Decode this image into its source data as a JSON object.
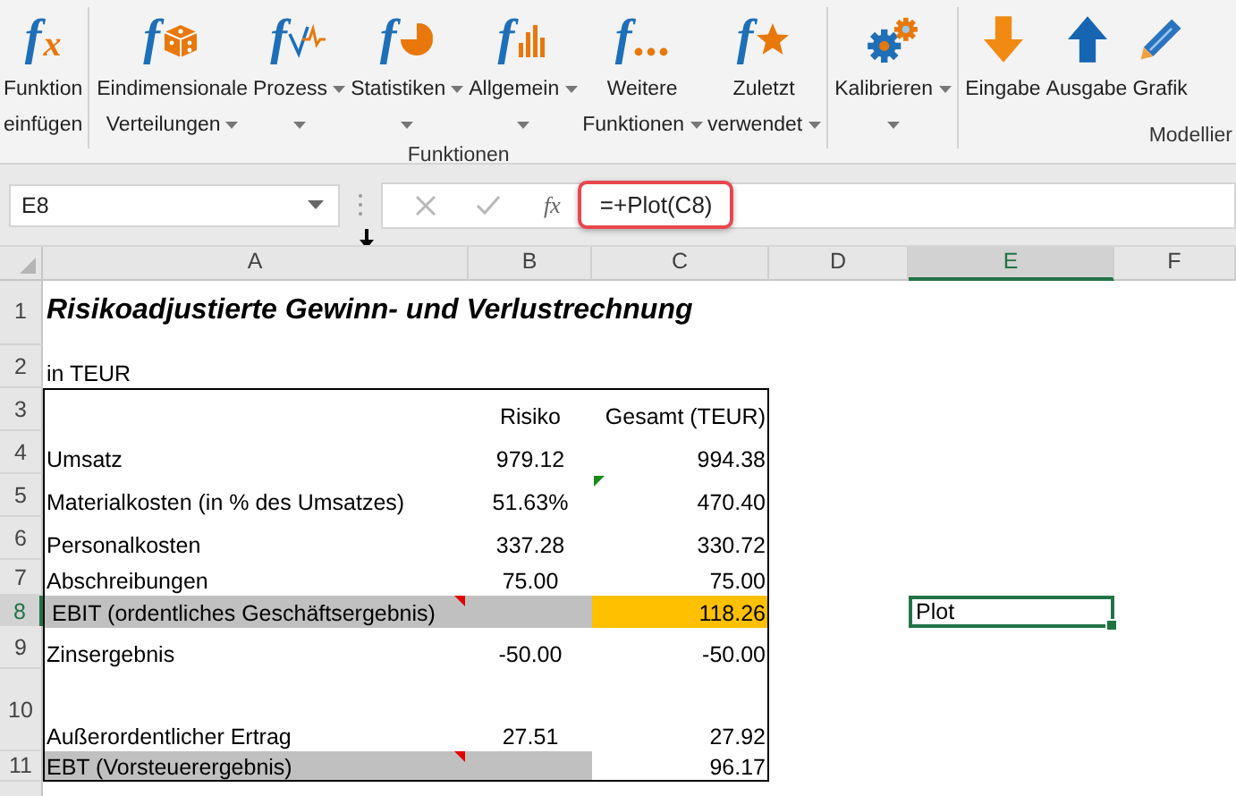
{
  "ribbon": {
    "groups": [
      {
        "items": [
          {
            "lines": [
              "Funktion",
              "einfügen"
            ],
            "glyph": "f",
            "accent": "x",
            "dropdown": false
          }
        ]
      },
      {
        "label": "Funktionen",
        "items": [
          {
            "lines": [
              "Eindimensionale",
              "Verteilungen"
            ],
            "glyph": "f",
            "dropdown": true
          },
          {
            "lines": [
              "Prozess"
            ],
            "glyph": "f",
            "dropdown": true
          },
          {
            "lines": [
              "Statistiken"
            ],
            "glyph": "f",
            "dropdown": true
          },
          {
            "lines": [
              "Allgemein"
            ],
            "glyph": "f",
            "dropdown": true
          },
          {
            "lines": [
              "Weitere",
              "Funktionen"
            ],
            "glyph": "f",
            "dropdown": true
          },
          {
            "lines": [
              "Zuletzt",
              "verwendet"
            ],
            "glyph": "f",
            "dropdown": true
          }
        ]
      },
      {
        "items": [
          {
            "lines": [
              "Kalibrieren"
            ],
            "dropdown": true
          }
        ]
      },
      {
        "label": "Modellier",
        "items": [
          {
            "lines": [
              "Eingabe"
            ],
            "dropdown": false
          },
          {
            "lines": [
              "Ausgabe"
            ],
            "dropdown": false
          },
          {
            "lines": [
              "Grafik"
            ],
            "dropdown": false
          }
        ]
      }
    ]
  },
  "formula_bar": {
    "name_box": "E8",
    "fx": "fx",
    "formula": "=+Plot(C8)",
    "highlighted": true
  },
  "columns": [
    {
      "label": "A",
      "selected": false
    },
    {
      "label": "B",
      "selected": false
    },
    {
      "label": "C",
      "selected": false
    },
    {
      "label": "D",
      "selected": false
    },
    {
      "label": "E",
      "selected": true
    },
    {
      "label": "F",
      "selected": false
    }
  ],
  "rows": [
    {
      "num": "1",
      "a": "Risikoadjustierte Gewinn- und Verlustrechnung",
      "kind": "title",
      "selected": false
    },
    {
      "num": "2",
      "a": "in TEUR",
      "kind": "text",
      "selected": false
    },
    {
      "num": "3",
      "b": "Risiko",
      "c": "Gesamt (TEUR)",
      "kind": "table",
      "selected": false
    },
    {
      "num": "4",
      "a": "Umsatz",
      "b": "979.12",
      "c": "994.38",
      "kind": "table",
      "selected": false
    },
    {
      "num": "5",
      "a": "Materialkosten (in % des Umsatzes)",
      "b": "51.63%",
      "c": "470.40",
      "c_error": true,
      "kind": "table",
      "selected": false
    },
    {
      "num": "6",
      "a": "Personalkosten",
      "b": "337.28",
      "c": "330.72",
      "kind": "table",
      "selected": false
    },
    {
      "num": "7",
      "a": "Abschreibungen",
      "b": "75.00",
      "c": "75.00",
      "kind": "table",
      "selected": false
    },
    {
      "num": "8",
      "a": "EBIT (ordentliches Geschäftsergebnis)",
      "indent": true,
      "c": "118.26",
      "shaded": true,
      "c_highlight": true,
      "a_comment": true,
      "e": "Plot",
      "kind": "table",
      "selected": true
    },
    {
      "num": "9",
      "a": "Zinsergebnis",
      "b": "-50.00",
      "c": "-50.00",
      "kind": "table",
      "selected": false
    },
    {
      "num": "10",
      "a": "Außerordentlicher Ertrag",
      "b": "27.51",
      "c": "27.92",
      "kind": "table",
      "selected": false
    },
    {
      "num": "11",
      "a": "EBT (Vorsteuerergebnis)",
      "c": "96.17",
      "shaded": true,
      "a_comment": true,
      "kind": "table",
      "selected": false
    }
  ]
}
